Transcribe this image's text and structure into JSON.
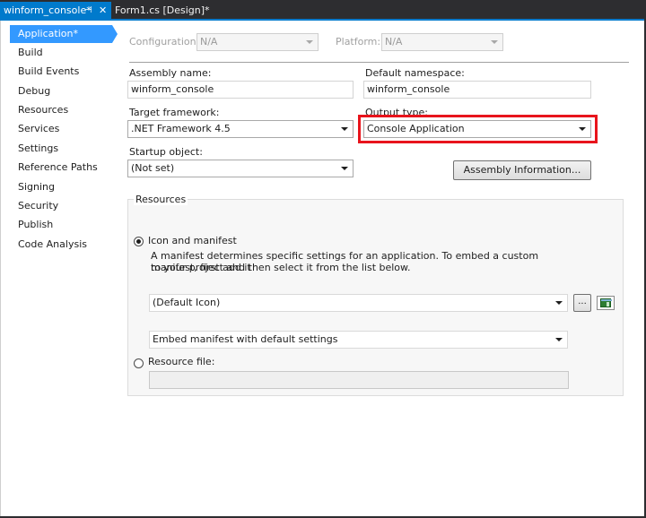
{
  "tabs": {
    "active": {
      "label": "winform_console*",
      "pin": "⊣",
      "close": "✕"
    },
    "inactive": {
      "label": "Form1.cs [Design]*"
    }
  },
  "sidebar": {
    "items": [
      {
        "label": "Application*"
      },
      {
        "label": "Build"
      },
      {
        "label": "Build Events"
      },
      {
        "label": "Debug"
      },
      {
        "label": "Resources"
      },
      {
        "label": "Services"
      },
      {
        "label": "Settings"
      },
      {
        "label": "Reference Paths"
      },
      {
        "label": "Signing"
      },
      {
        "label": "Security"
      },
      {
        "label": "Publish"
      },
      {
        "label": "Code Analysis"
      }
    ]
  },
  "config": {
    "configuration_label": "Configuration:",
    "configuration_value": "N/A",
    "platform_label": "Platform:",
    "platform_value": "N/A"
  },
  "form": {
    "assembly_name_label": "Assembly name:",
    "assembly_name_value": "winform_console",
    "default_namespace_label": "Default namespace:",
    "default_namespace_value": "winform_console",
    "target_framework_label": "Target framework:",
    "target_framework_value": ".NET Framework 4.5",
    "output_type_label": "Output type:",
    "output_type_value": "Console Application",
    "startup_object_label": "Startup object:",
    "startup_object_value": "(Not set)",
    "assembly_info_button": "Assembly Information..."
  },
  "resources": {
    "group_label": "Resources",
    "icon_manifest_label": "Icon and manifest",
    "description_line1": "A manifest determines specific settings for an application. To embed a custom manifest, first add it",
    "description_line2": "to your project and then select it from the list below.",
    "icon_value": "(Default Icon)",
    "browse_button": "...",
    "manifest_value": "Embed manifest with default settings",
    "resource_file_label": "Resource file:",
    "resource_file_value": ""
  },
  "colors": {
    "accent": "#007acc",
    "selection": "#3399ff",
    "highlight_box": "#e8141c"
  }
}
